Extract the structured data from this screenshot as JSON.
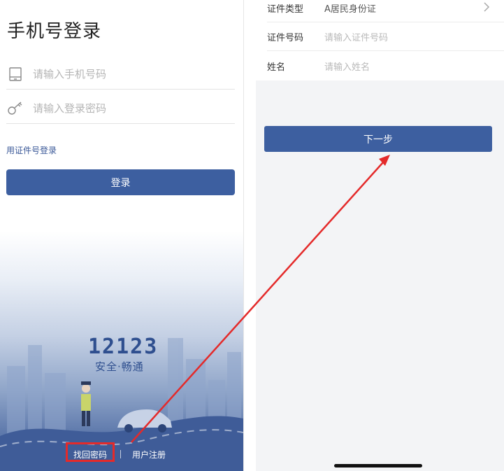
{
  "left": {
    "title": "手机号登录",
    "phone_placeholder": "请输入手机号码",
    "password_placeholder": "请输入登录密码",
    "id_login_link": "用证件号登录",
    "login_button": "登录",
    "logo_number": "12123",
    "logo_slogan": "安全·畅通",
    "find_password": "找回密码",
    "register": "用户注册"
  },
  "right": {
    "rows": [
      {
        "label": "证件类型",
        "value": "A居民身份证"
      },
      {
        "label": "证件号码",
        "placeholder": "请输入证件号码"
      },
      {
        "label": "姓名",
        "placeholder": "请输入姓名"
      }
    ],
    "next_button": "下一步"
  },
  "colors": {
    "primary_button": "#3d5fa0",
    "link": "#3b5998",
    "annotation": "#e42a2a"
  },
  "icons": [
    "phone-icon",
    "key-icon",
    "chevron-right-icon",
    "police-officer-illustration",
    "car-illustration"
  ]
}
